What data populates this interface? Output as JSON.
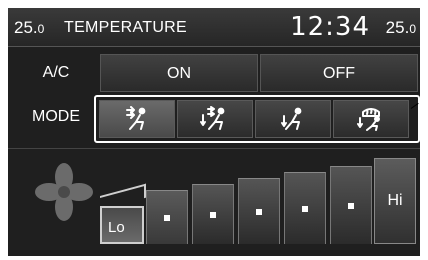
{
  "header": {
    "temp_left_whole": "25.",
    "temp_left_decimal": "0",
    "title": "TEMPERATURE",
    "clock": "12:34",
    "temp_right_whole": "25.",
    "temp_right_decimal": "0"
  },
  "ac": {
    "label": "A/C",
    "on_label": "ON",
    "off_label": "OFF"
  },
  "mode": {
    "label": "MODE",
    "buttons": [
      {
        "icon": "vent-face-icon",
        "selected": true
      },
      {
        "icon": "bilevel-icon",
        "selected": false
      },
      {
        "icon": "floor-icon",
        "selected": false
      },
      {
        "icon": "floor-defrost-icon",
        "selected": false
      }
    ]
  },
  "fan": {
    "icon": "fan-icon",
    "lo_label": "Lo",
    "hi_label": "Hi",
    "total_levels": 7,
    "current_level": 2
  },
  "colors": {
    "background": "#1f1f1f",
    "text": "#ffffff",
    "frame": "#ffffff"
  }
}
